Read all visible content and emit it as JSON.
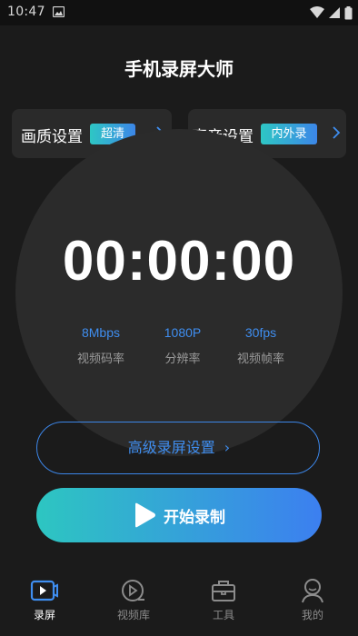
{
  "status_bar": {
    "time": "10:47"
  },
  "header": {
    "title": "手机录屏大师"
  },
  "settings": {
    "quality": {
      "label": "画质设置",
      "badge": "超清"
    },
    "audio": {
      "label": "声音设置",
      "badge": "内外录"
    }
  },
  "timer": {
    "display": "00:00:00"
  },
  "stats": [
    {
      "value": "8Mbps",
      "label": "视频码率"
    },
    {
      "value": "1080P",
      "label": "分辨率"
    },
    {
      "value": "30fps",
      "label": "视频帧率"
    }
  ],
  "advanced": {
    "label": "高级录屏设置"
  },
  "start": {
    "label": "开始录制"
  },
  "tabs": [
    {
      "label": "录屏",
      "icon": "record-screen-icon",
      "active": true
    },
    {
      "label": "视频库",
      "icon": "video-library-icon",
      "active": false
    },
    {
      "label": "工具",
      "icon": "toolbox-icon",
      "active": false
    },
    {
      "label": "我的",
      "icon": "profile-icon",
      "active": false
    }
  ],
  "colors": {
    "accent_blue": "#3f8ef0",
    "accent_teal": "#2ec7c4",
    "background": "#1b1b1b",
    "card": "#2a2a2a"
  }
}
